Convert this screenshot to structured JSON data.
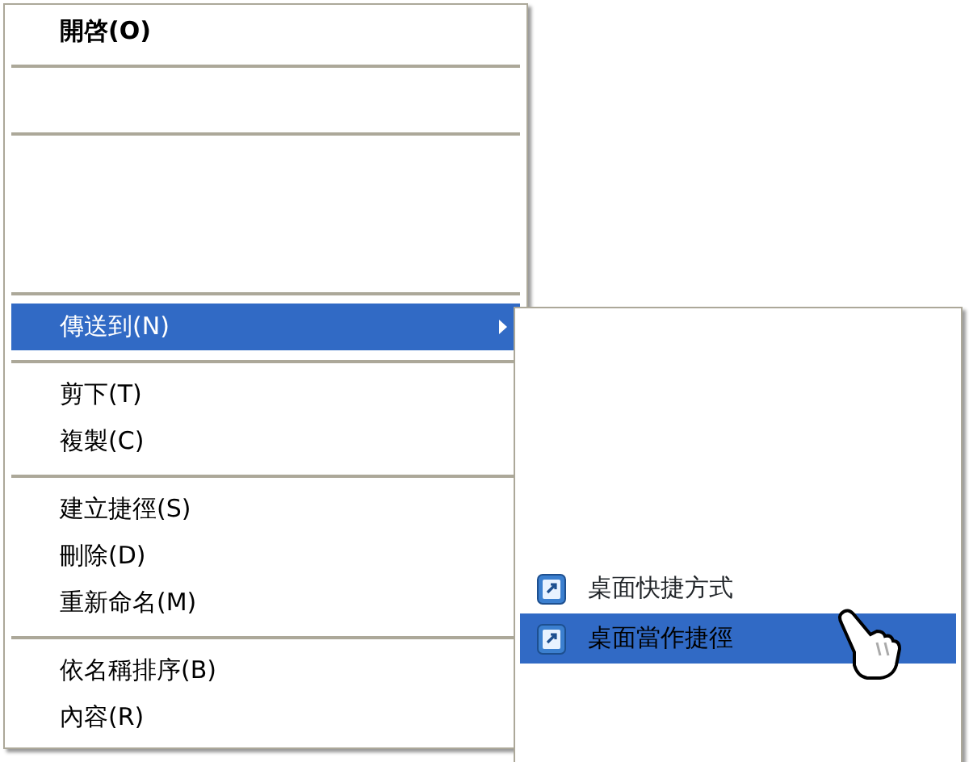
{
  "context_menu": {
    "items": [
      {
        "kind": "item",
        "label": "開啓(O)",
        "default": true,
        "selected": false,
        "submenu": false
      },
      {
        "kind": "separator"
      },
      {
        "kind": "blank"
      },
      {
        "kind": "separator"
      },
      {
        "kind": "gap"
      },
      {
        "kind": "separator"
      },
      {
        "kind": "item",
        "label": "傳送到(N)",
        "default": false,
        "selected": true,
        "submenu": true
      },
      {
        "kind": "separator"
      },
      {
        "kind": "item",
        "label": "剪下(T)",
        "default": false,
        "selected": false,
        "submenu": false
      },
      {
        "kind": "item",
        "label": "複製(C)",
        "default": false,
        "selected": false,
        "submenu": false
      },
      {
        "kind": "separator"
      },
      {
        "kind": "item",
        "label": "建立捷徑(S)",
        "default": false,
        "selected": false,
        "submenu": false
      },
      {
        "kind": "item",
        "label": "刪除(D)",
        "default": false,
        "selected": false,
        "submenu": false
      },
      {
        "kind": "item",
        "label": "重新命名(M)",
        "default": false,
        "selected": false,
        "submenu": false
      },
      {
        "kind": "separator"
      },
      {
        "kind": "item",
        "label": "依名稱排序(B)",
        "default": false,
        "selected": false,
        "submenu": false
      },
      {
        "kind": "item",
        "label": "內容(R)",
        "default": false,
        "selected": false,
        "submenu": false
      }
    ]
  },
  "submenu": {
    "items": [
      {
        "label": "桌面快捷方式",
        "selected": false
      },
      {
        "label": "桌面當作捷徑",
        "selected": true
      }
    ]
  }
}
